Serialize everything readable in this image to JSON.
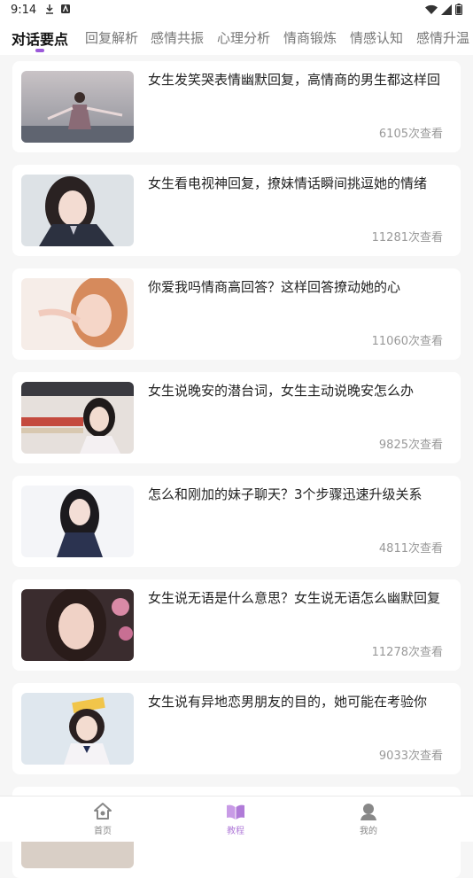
{
  "status_bar": {
    "time": "9:14",
    "icons": [
      "download-icon",
      "app-notification-icon",
      "wifi-icon",
      "signal-icon",
      "battery-icon"
    ]
  },
  "tabs": [
    {
      "label": "对话要点",
      "active": true
    },
    {
      "label": "回复解析"
    },
    {
      "label": "感情共振"
    },
    {
      "label": "心理分析"
    },
    {
      "label": "情商锻炼"
    },
    {
      "label": "情感认知"
    },
    {
      "label": "感情升温"
    }
  ],
  "articles": [
    {
      "title": "女生发笑哭表情幽默回复，高情商的男生都这样回",
      "views": "6105次查看"
    },
    {
      "title": "女生看电视神回复，撩妹情话瞬间挑逗她的情绪",
      "views": "11281次查看"
    },
    {
      "title": "你爱我吗情商高回答？这样回答撩动她的心",
      "views": "11060次查看"
    },
    {
      "title": "女生说晚安的潜台词，女生主动说晚安怎么办",
      "views": "9825次查看"
    },
    {
      "title": "怎么和刚加的妹子聊天？3个步骤迅速升级关系",
      "views": "4811次查看"
    },
    {
      "title": "女生说无语是什么意思？女生说无语怎么幽默回复",
      "views": "11278次查看"
    },
    {
      "title": "女生说有异地恋男朋友的目的，她可能在考验你",
      "views": "9033次查看"
    }
  ],
  "bottom_nav": [
    {
      "label": "首页",
      "icon": "home-icon"
    },
    {
      "label": "教程",
      "icon": "book-icon",
      "active": true
    },
    {
      "label": "我的",
      "icon": "user-icon"
    }
  ],
  "colors": {
    "accent": "#9b59d9",
    "nav_active": "#b07bd8",
    "background": "#f6f6f6"
  }
}
